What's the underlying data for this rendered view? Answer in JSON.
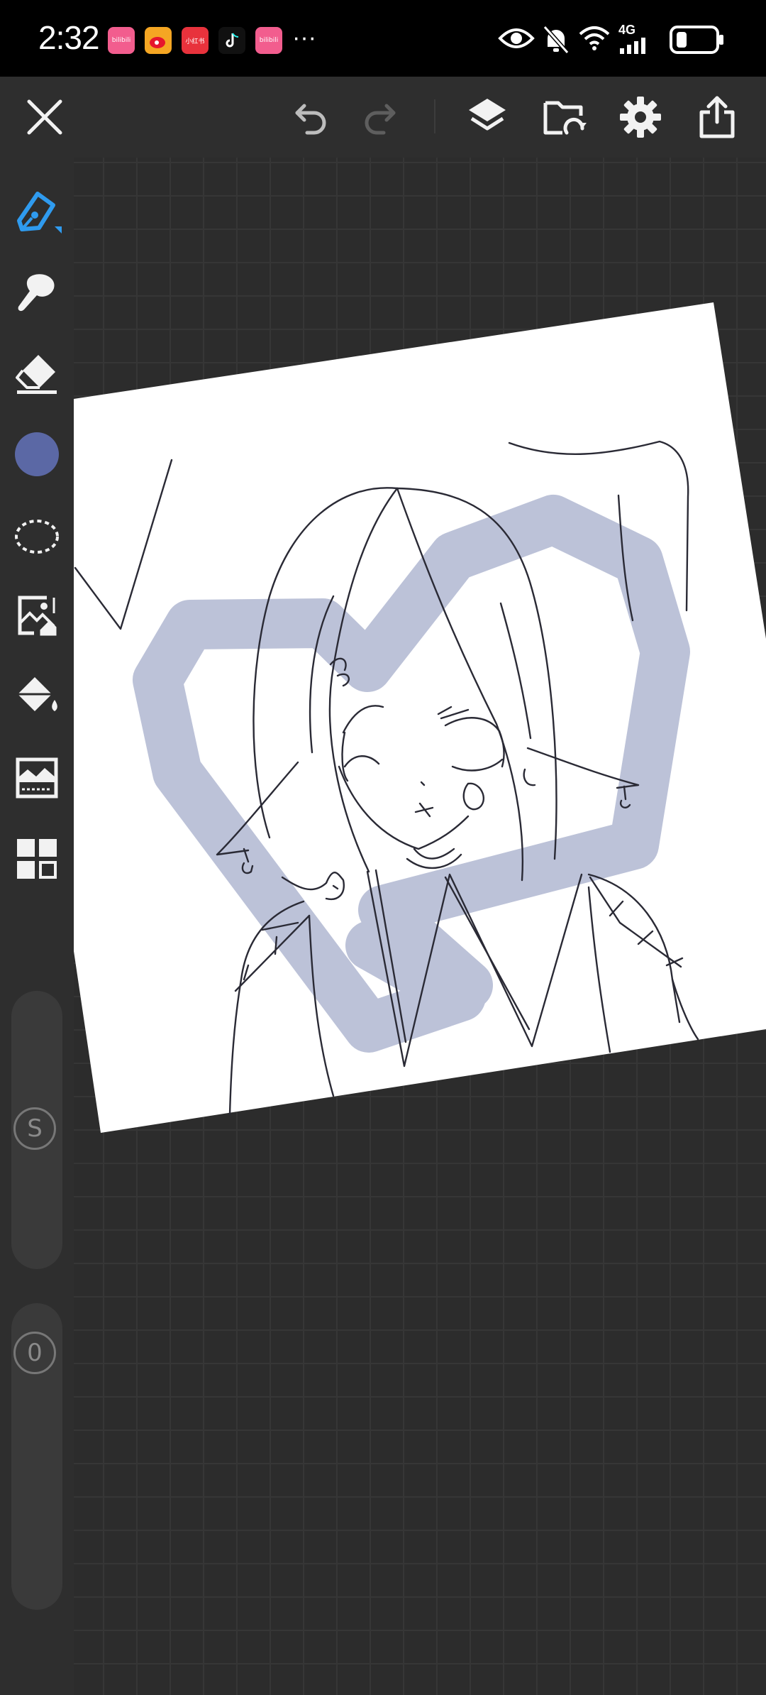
{
  "status_bar": {
    "time": "2:32",
    "apps": [
      {
        "icon": "bilibili-icon",
        "label": "bilibili",
        "color": "#f25d8e"
      },
      {
        "icon": "weibo-icon",
        "label": "",
        "color": "#f5a623"
      },
      {
        "icon": "xiaohongshu-icon",
        "label": "小红书",
        "color": "#e8323c"
      },
      {
        "icon": "tiktok-icon",
        "label": "",
        "color": "#111111"
      },
      {
        "icon": "bilibili-icon",
        "label": "bilibili",
        "color": "#f25d8e"
      }
    ],
    "more": "···",
    "network": "4G"
  },
  "toolbar": {
    "close": "close-icon",
    "undo": "undo-icon",
    "redo": "redo-icon",
    "layers": "layers-icon",
    "import": "folder-import-icon",
    "settings": "gear-icon",
    "export": "share-icon"
  },
  "tools": [
    {
      "name": "pen-tool",
      "icon": "pen-icon",
      "active": true,
      "accent": "#2f9bef"
    },
    {
      "name": "smudge-tool",
      "icon": "smudge-icon"
    },
    {
      "name": "eraser-tool",
      "icon": "eraser-icon"
    },
    {
      "name": "color-picker",
      "icon": "color-swatch",
      "color": "#5b68a5"
    },
    {
      "name": "lasso-tool",
      "icon": "lasso-icon"
    },
    {
      "name": "image-import-tool",
      "icon": "image-icon"
    },
    {
      "name": "fill-tool",
      "icon": "paint-bucket-icon"
    },
    {
      "name": "adjust-tool",
      "icon": "adjust-image-icon"
    },
    {
      "name": "gallery-tool",
      "icon": "grid-icon"
    }
  ],
  "size_slider": {
    "label": "S"
  },
  "opacity_slider": {
    "label": "0"
  },
  "drawing": {
    "paper_color": "#ffffff",
    "stroke_color": "#bcc2d8"
  }
}
